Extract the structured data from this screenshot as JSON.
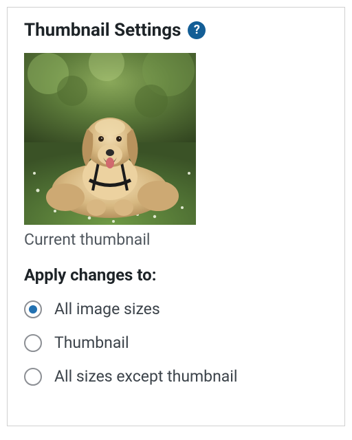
{
  "panel": {
    "title": "Thumbnail Settings",
    "help_icon_glyph": "?",
    "thumbnail_caption": "Current thumbnail",
    "apply_label": "Apply changes to:"
  },
  "apply_options": [
    {
      "label": "All image sizes",
      "selected": true
    },
    {
      "label": "Thumbnail",
      "selected": false
    },
    {
      "label": "All sizes except thumbnail",
      "selected": false
    }
  ]
}
